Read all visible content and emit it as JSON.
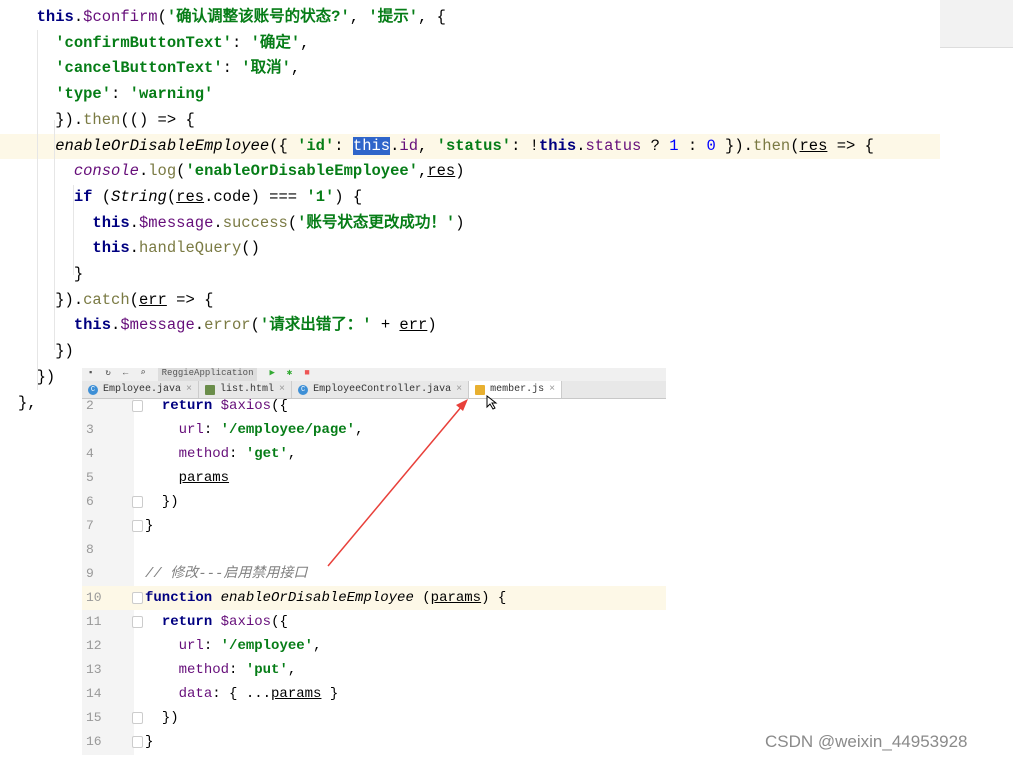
{
  "top_code": {
    "highlight_line": 5,
    "lines": [
      {
        "indent": 1,
        "tokens": [
          [
            "this",
            "kw"
          ],
          [
            ".",
            ""
          ],
          [
            "$confirm",
            "prop"
          ],
          [
            "(",
            "pl"
          ],
          [
            "'确认调整该账号的状态?'",
            "str"
          ],
          [
            ", ",
            ""
          ],
          [
            "'提示'",
            "str"
          ],
          [
            ", {",
            ""
          ]
        ]
      },
      {
        "indent": 2,
        "tokens": [
          [
            "'confirmButtonText'",
            "str"
          ],
          [
            ": ",
            ""
          ],
          [
            "'确定'",
            "str"
          ],
          [
            ",",
            ""
          ]
        ]
      },
      {
        "indent": 2,
        "tokens": [
          [
            "'cancelButtonText'",
            "str"
          ],
          [
            ": ",
            ""
          ],
          [
            "'取消'",
            "str"
          ],
          [
            ",",
            ""
          ]
        ]
      },
      {
        "indent": 2,
        "tokens": [
          [
            "'type'",
            "str"
          ],
          [
            ": ",
            ""
          ],
          [
            "'warning'",
            "str"
          ]
        ]
      },
      {
        "indent": 2,
        "tokens": [
          [
            "}).",
            ""
          ],
          [
            "then",
            "mth"
          ],
          [
            "(() => {",
            ""
          ]
        ]
      },
      {
        "indent": 2,
        "tokens": [
          [
            "enableOrDisableEmployee",
            "fn"
          ],
          [
            "({ ",
            ""
          ],
          [
            "'id'",
            "str"
          ],
          [
            ": ",
            ""
          ],
          [
            "this",
            "sel"
          ],
          [
            ".",
            ""
          ],
          [
            "id",
            "prop"
          ],
          [
            ", ",
            ""
          ],
          [
            "'status'",
            "str"
          ],
          [
            ": !",
            ""
          ],
          [
            "this",
            "kw"
          ],
          [
            ".",
            ""
          ],
          [
            "status",
            "prop"
          ],
          [
            " ? ",
            ""
          ],
          [
            "1",
            "num"
          ],
          [
            " : ",
            ""
          ],
          [
            "0",
            "num"
          ],
          [
            " }).",
            ""
          ],
          [
            "then",
            "mth"
          ],
          [
            "(",
            ""
          ],
          [
            "res",
            "ul"
          ],
          [
            " => {",
            ""
          ]
        ]
      },
      {
        "indent": 3,
        "tokens": [
          [
            "console",
            "it"
          ],
          [
            ".",
            ""
          ],
          [
            "log",
            "mth"
          ],
          [
            "(",
            ""
          ],
          [
            "'enableOrDisableEmployee'",
            "str"
          ],
          [
            ",",
            ""
          ],
          [
            "res",
            "ul"
          ],
          [
            ")",
            ""
          ]
        ]
      },
      {
        "indent": 3,
        "tokens": [
          [
            "if",
            "kw"
          ],
          [
            " (",
            ""
          ],
          [
            "String",
            "cls"
          ],
          [
            "(",
            ""
          ],
          [
            "res",
            "ul"
          ],
          [
            ".code) === ",
            ""
          ],
          [
            "'1'",
            "str"
          ],
          [
            ") {",
            ""
          ]
        ]
      },
      {
        "indent": 4,
        "tokens": [
          [
            "this",
            "kw"
          ],
          [
            ".",
            ""
          ],
          [
            "$message",
            "prop"
          ],
          [
            ".",
            ""
          ],
          [
            "success",
            "mth"
          ],
          [
            "(",
            ""
          ],
          [
            "'账号状态更改成功！'",
            "str"
          ],
          [
            ")",
            ""
          ]
        ]
      },
      {
        "indent": 4,
        "tokens": [
          [
            "this",
            "kw"
          ],
          [
            ".",
            ""
          ],
          [
            "handleQuery",
            "mth"
          ],
          [
            "()",
            ""
          ]
        ]
      },
      {
        "indent": 3,
        "tokens": [
          [
            "}",
            ""
          ]
        ]
      },
      {
        "indent": 2,
        "tokens": [
          [
            "}).",
            ""
          ],
          [
            "catch",
            "mth"
          ],
          [
            "(",
            ""
          ],
          [
            "err",
            "ul"
          ],
          [
            " => {",
            ""
          ]
        ]
      },
      {
        "indent": 3,
        "tokens": [
          [
            "this",
            "kw"
          ],
          [
            ".",
            ""
          ],
          [
            "$message",
            "prop"
          ],
          [
            ".",
            ""
          ],
          [
            "error",
            "mth"
          ],
          [
            "(",
            ""
          ],
          [
            "'请求出错了：'",
            "str"
          ],
          [
            " + ",
            ""
          ],
          [
            "err",
            "ul"
          ],
          [
            ")",
            ""
          ]
        ]
      },
      {
        "indent": 2,
        "tokens": [
          [
            "})",
            ""
          ]
        ]
      },
      {
        "indent": 1,
        "tokens": [
          [
            "})",
            ""
          ]
        ]
      },
      {
        "indent": 0,
        "tokens": [
          [
            "},",
            ""
          ]
        ]
      }
    ]
  },
  "ide": {
    "toolbar_run_config": "ReggieApplication",
    "tabs": [
      {
        "label": "Employee.java",
        "icon": "java-class-icon",
        "active": false
      },
      {
        "label": "list.html",
        "icon": "html-file-icon",
        "active": false
      },
      {
        "label": "EmployeeController.java",
        "icon": "java-class-icon",
        "active": false
      },
      {
        "label": "member.js",
        "icon": "js-file-icon",
        "active": true
      }
    ],
    "highlight_line": 10,
    "lines": [
      {
        "n": "2",
        "indent": 1,
        "fold": true,
        "tokens": [
          [
            "return",
            "kw"
          ],
          [
            " ",
            ""
          ],
          [
            "$axios",
            "prop"
          ],
          [
            "({",
            ""
          ]
        ]
      },
      {
        "n": "3",
        "indent": 2,
        "tokens": [
          [
            "url",
            "prop"
          ],
          [
            ": ",
            ""
          ],
          [
            "'/employee/page'",
            "str"
          ],
          [
            ",",
            ""
          ]
        ]
      },
      {
        "n": "4",
        "indent": 2,
        "tokens": [
          [
            "method",
            "prop"
          ],
          [
            ": ",
            ""
          ],
          [
            "'get'",
            "str"
          ],
          [
            ",",
            ""
          ]
        ]
      },
      {
        "n": "5",
        "indent": 2,
        "tokens": [
          [
            "params",
            "ul"
          ]
        ]
      },
      {
        "n": "6",
        "indent": 1,
        "fold": true,
        "tokens": [
          [
            "})",
            ""
          ]
        ]
      },
      {
        "n": "7",
        "indent": 0,
        "fold": true,
        "tokens": [
          [
            "}",
            ""
          ]
        ]
      },
      {
        "n": "8",
        "indent": 0,
        "tokens": []
      },
      {
        "n": "9",
        "indent": 0,
        "tokens": [
          [
            "// 修改---启用禁用接口",
            "cm"
          ]
        ]
      },
      {
        "n": "10",
        "indent": 0,
        "fold": true,
        "tokens": [
          [
            "function",
            "kw"
          ],
          [
            " ",
            ""
          ],
          [
            "enableOrDisableEmployee",
            "fn"
          ],
          [
            " (",
            ""
          ],
          [
            "params",
            "ul"
          ],
          [
            ") {",
            ""
          ]
        ]
      },
      {
        "n": "11",
        "indent": 1,
        "fold": true,
        "tokens": [
          [
            "return",
            "kw"
          ],
          [
            " ",
            ""
          ],
          [
            "$axios",
            "prop"
          ],
          [
            "({",
            ""
          ]
        ]
      },
      {
        "n": "12",
        "indent": 2,
        "tokens": [
          [
            "url",
            "prop"
          ],
          [
            ": ",
            ""
          ],
          [
            "'/employee'",
            "str"
          ],
          [
            ",",
            ""
          ]
        ]
      },
      {
        "n": "13",
        "indent": 2,
        "tokens": [
          [
            "method",
            "prop"
          ],
          [
            ": ",
            ""
          ],
          [
            "'put'",
            "str"
          ],
          [
            ",",
            ""
          ]
        ]
      },
      {
        "n": "14",
        "indent": 2,
        "tokens": [
          [
            "data",
            "prop"
          ],
          [
            ": { ...",
            ""
          ],
          [
            "params",
            "ul"
          ],
          [
            " }",
            ""
          ]
        ]
      },
      {
        "n": "15",
        "indent": 1,
        "fold": true,
        "tokens": [
          [
            "})",
            ""
          ]
        ]
      },
      {
        "n": "16",
        "indent": 0,
        "fold": true,
        "tokens": [
          [
            "}",
            ""
          ]
        ]
      }
    ]
  },
  "annotation_arrow_color": "#e8403a",
  "watermark": "CSDN @weixin_44953928"
}
